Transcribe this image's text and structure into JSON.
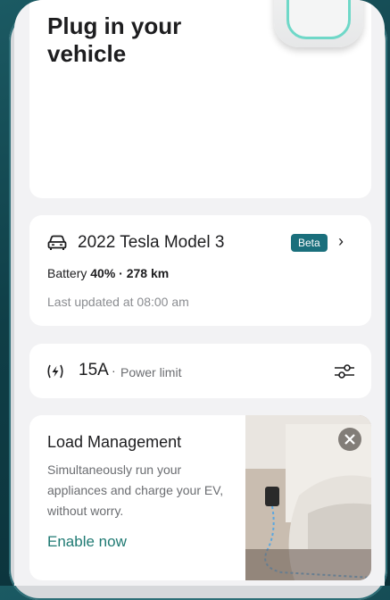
{
  "plug_card": {
    "title": "Plug in your vehicle"
  },
  "vehicle": {
    "name": "2022 Tesla Model 3",
    "badge": "Beta",
    "battery_prefix": "Battery ",
    "battery_percent": "40%",
    "range": " · 278 km",
    "last_updated": "Last updated at 08:00 am"
  },
  "power": {
    "value": "15A",
    "separator": "·",
    "label": "Power limit"
  },
  "load_management": {
    "title": "Load Management",
    "description": "Simultaneously run your appliances and charge your EV, without worry.",
    "action": "Enable now"
  },
  "colors": {
    "accent": "#1f7a73",
    "badge_bg": "#1a6f7c",
    "charger_ring": "#6fd8c8",
    "background": "#0f3e47"
  },
  "icons": [
    "car-icon",
    "bolt-icon",
    "settings-sliders-icon",
    "chevron-right-icon",
    "close-icon"
  ]
}
